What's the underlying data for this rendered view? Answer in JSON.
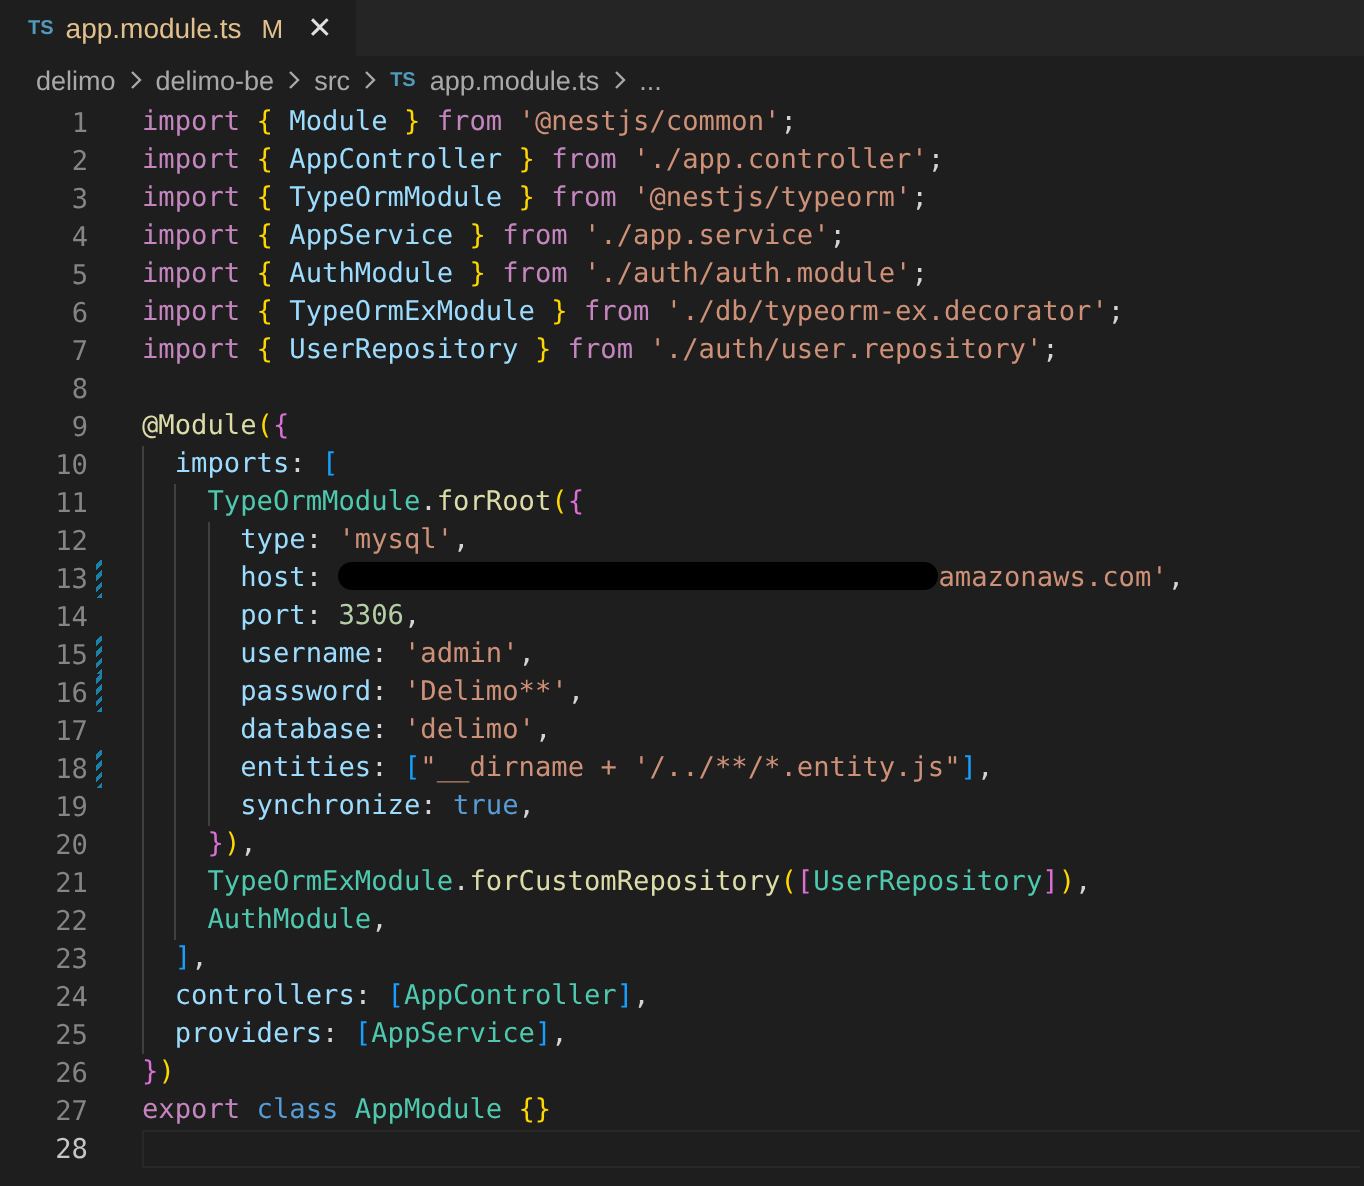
{
  "tab": {
    "icon_label": "TS",
    "title": "app.module.ts",
    "status": "M",
    "selected": true,
    "modified": true,
    "close": "✕"
  },
  "breadcrumbs": [
    {
      "text": "delimo"
    },
    {
      "text": "delimo-be"
    },
    {
      "text": "src"
    },
    {
      "text": "app.module.ts",
      "icon_label": "TS"
    },
    {
      "text": "..."
    }
  ],
  "lines": [
    {
      "number": "1",
      "modified": false,
      "current": false,
      "tokens": [
        {
          "kind": "kw",
          "text": "import "
        },
        {
          "kind": "b1",
          "text": "{"
        },
        {
          "kind": "var",
          "text": " Module "
        },
        {
          "kind": "b1",
          "text": "}"
        },
        {
          "kind": "kw",
          "text": " from "
        },
        {
          "kind": "str",
          "text": "'@nestjs/common'"
        },
        {
          "kind": "p",
          "text": ";"
        }
      ]
    },
    {
      "number": "2",
      "modified": false,
      "current": false,
      "tokens": [
        {
          "kind": "kw",
          "text": "import "
        },
        {
          "kind": "b1",
          "text": "{"
        },
        {
          "kind": "var",
          "text": " AppController "
        },
        {
          "kind": "b1",
          "text": "}"
        },
        {
          "kind": "kw",
          "text": " from "
        },
        {
          "kind": "str",
          "text": "'./app.controller'"
        },
        {
          "kind": "p",
          "text": ";"
        }
      ]
    },
    {
      "number": "3",
      "modified": false,
      "current": false,
      "tokens": [
        {
          "kind": "kw",
          "text": "import "
        },
        {
          "kind": "b1",
          "text": "{"
        },
        {
          "kind": "var",
          "text": " TypeOrmModule "
        },
        {
          "kind": "b1",
          "text": "}"
        },
        {
          "kind": "kw",
          "text": " from "
        },
        {
          "kind": "str",
          "text": "'@nestjs/typeorm'"
        },
        {
          "kind": "p",
          "text": ";"
        }
      ]
    },
    {
      "number": "4",
      "modified": false,
      "current": false,
      "tokens": [
        {
          "kind": "kw",
          "text": "import "
        },
        {
          "kind": "b1",
          "text": "{"
        },
        {
          "kind": "var",
          "text": " AppService "
        },
        {
          "kind": "b1",
          "text": "}"
        },
        {
          "kind": "kw",
          "text": " from "
        },
        {
          "kind": "str",
          "text": "'./app.service'"
        },
        {
          "kind": "p",
          "text": ";"
        }
      ]
    },
    {
      "number": "5",
      "modified": false,
      "current": false,
      "tokens": [
        {
          "kind": "kw",
          "text": "import "
        },
        {
          "kind": "b1",
          "text": "{"
        },
        {
          "kind": "var",
          "text": " AuthModule "
        },
        {
          "kind": "b1",
          "text": "}"
        },
        {
          "kind": "kw",
          "text": " from "
        },
        {
          "kind": "str",
          "text": "'./auth/auth.module'"
        },
        {
          "kind": "p",
          "text": ";"
        }
      ]
    },
    {
      "number": "6",
      "modified": false,
      "current": false,
      "tokens": [
        {
          "kind": "kw",
          "text": "import "
        },
        {
          "kind": "b1",
          "text": "{"
        },
        {
          "kind": "var",
          "text": " TypeOrmExModule "
        },
        {
          "kind": "b1",
          "text": "}"
        },
        {
          "kind": "kw",
          "text": " from "
        },
        {
          "kind": "str",
          "text": "'./db/typeorm-ex.decorator'"
        },
        {
          "kind": "p",
          "text": ";"
        }
      ]
    },
    {
      "number": "7",
      "modified": false,
      "current": false,
      "tokens": [
        {
          "kind": "kw",
          "text": "import "
        },
        {
          "kind": "b1",
          "text": "{"
        },
        {
          "kind": "var",
          "text": " UserRepository "
        },
        {
          "kind": "b1",
          "text": "}"
        },
        {
          "kind": "kw",
          "text": " from "
        },
        {
          "kind": "str",
          "text": "'./auth/user.repository'"
        },
        {
          "kind": "p",
          "text": ";"
        }
      ]
    },
    {
      "number": "8",
      "modified": false,
      "current": false
    },
    {
      "number": "9",
      "modified": false,
      "current": false,
      "tokens": [
        {
          "kind": "fn",
          "text": "@Module"
        },
        {
          "kind": "b1",
          "text": "("
        },
        {
          "kind": "b2",
          "text": "{"
        }
      ]
    },
    {
      "number": "10",
      "modified": false,
      "current": false,
      "tokens": [
        {
          "kind": "indent"
        },
        {
          "kind": "var",
          "text": "imports"
        },
        {
          "kind": "p",
          "text": ": "
        },
        {
          "kind": "b3",
          "text": "["
        }
      ]
    },
    {
      "number": "11",
      "modified": false,
      "current": false,
      "tokens": [
        {
          "kind": "indent"
        },
        {
          "kind": "indent"
        },
        {
          "kind": "type",
          "text": "TypeOrmModule"
        },
        {
          "kind": "p",
          "text": "."
        },
        {
          "kind": "fn",
          "text": "forRoot"
        },
        {
          "kind": "b1",
          "text": "("
        },
        {
          "kind": "b2",
          "text": "{"
        }
      ]
    },
    {
      "number": "12",
      "modified": false,
      "current": false,
      "tokens": [
        {
          "kind": "indent"
        },
        {
          "kind": "indent"
        },
        {
          "kind": "indent"
        },
        {
          "kind": "var",
          "text": "type"
        },
        {
          "kind": "p",
          "text": ": "
        },
        {
          "kind": "str",
          "text": "'mysql'"
        },
        {
          "kind": "p",
          "text": ","
        }
      ]
    },
    {
      "number": "13",
      "modified": true,
      "current": false,
      "tokens": [
        {
          "kind": "indent"
        },
        {
          "kind": "indent"
        },
        {
          "kind": "indent"
        },
        {
          "kind": "var",
          "text": "host"
        },
        {
          "kind": "p",
          "text": ": "
        },
        {
          "kind": "redacted"
        },
        {
          "kind": "str",
          "text": "amazonaws.com'"
        },
        {
          "kind": "p",
          "text": ","
        }
      ]
    },
    {
      "number": "14",
      "modified": false,
      "current": false,
      "tokens": [
        {
          "kind": "indent"
        },
        {
          "kind": "indent"
        },
        {
          "kind": "indent"
        },
        {
          "kind": "var",
          "text": "port"
        },
        {
          "kind": "p",
          "text": ": "
        },
        {
          "kind": "num",
          "text": "3306"
        },
        {
          "kind": "p",
          "text": ","
        }
      ]
    },
    {
      "number": "15",
      "modified": true,
      "current": false,
      "tokens": [
        {
          "kind": "indent"
        },
        {
          "kind": "indent"
        },
        {
          "kind": "indent"
        },
        {
          "kind": "var",
          "text": "username"
        },
        {
          "kind": "p",
          "text": ": "
        },
        {
          "kind": "str",
          "text": "'admin'"
        },
        {
          "kind": "p",
          "text": ","
        }
      ]
    },
    {
      "number": "16",
      "modified": true,
      "current": false,
      "tokens": [
        {
          "kind": "indent"
        },
        {
          "kind": "indent"
        },
        {
          "kind": "indent"
        },
        {
          "kind": "var",
          "text": "password"
        },
        {
          "kind": "p",
          "text": ": "
        },
        {
          "kind": "str",
          "text": "'Delimo**'"
        },
        {
          "kind": "p",
          "text": ","
        }
      ]
    },
    {
      "number": "17",
      "modified": false,
      "current": false,
      "tokens": [
        {
          "kind": "indent"
        },
        {
          "kind": "indent"
        },
        {
          "kind": "indent"
        },
        {
          "kind": "var",
          "text": "database"
        },
        {
          "kind": "p",
          "text": ": "
        },
        {
          "kind": "str",
          "text": "'delimo'"
        },
        {
          "kind": "p",
          "text": ","
        }
      ]
    },
    {
      "number": "18",
      "modified": true,
      "current": false,
      "tokens": [
        {
          "kind": "indent"
        },
        {
          "kind": "indent"
        },
        {
          "kind": "indent"
        },
        {
          "kind": "var",
          "text": "entities"
        },
        {
          "kind": "p",
          "text": ": "
        },
        {
          "kind": "b3",
          "text": "["
        },
        {
          "kind": "str",
          "text": "\"__dirname + '/../**/*.entity.js\""
        },
        {
          "kind": "b3",
          "text": "]"
        },
        {
          "kind": "p",
          "text": ","
        }
      ]
    },
    {
      "number": "19",
      "modified": false,
      "current": false,
      "tokens": [
        {
          "kind": "indent"
        },
        {
          "kind": "indent"
        },
        {
          "kind": "indent"
        },
        {
          "kind": "var",
          "text": "synchronize"
        },
        {
          "kind": "p",
          "text": ": "
        },
        {
          "kind": "const",
          "text": "true"
        },
        {
          "kind": "p",
          "text": ","
        }
      ]
    },
    {
      "number": "20",
      "modified": false,
      "current": false,
      "tokens": [
        {
          "kind": "indent"
        },
        {
          "kind": "indent"
        },
        {
          "kind": "b2",
          "text": "}"
        },
        {
          "kind": "b1",
          "text": ")"
        },
        {
          "kind": "p",
          "text": ","
        }
      ]
    },
    {
      "number": "21",
      "modified": false,
      "current": false,
      "tokens": [
        {
          "kind": "indent"
        },
        {
          "kind": "indent"
        },
        {
          "kind": "type",
          "text": "TypeOrmExModule"
        },
        {
          "kind": "p",
          "text": "."
        },
        {
          "kind": "fn",
          "text": "forCustomRepository"
        },
        {
          "kind": "b1",
          "text": "("
        },
        {
          "kind": "b2",
          "text": "["
        },
        {
          "kind": "type",
          "text": "UserRepository"
        },
        {
          "kind": "b2",
          "text": "]"
        },
        {
          "kind": "b1",
          "text": ")"
        },
        {
          "kind": "p",
          "text": ","
        }
      ]
    },
    {
      "number": "22",
      "modified": false,
      "current": false,
      "tokens": [
        {
          "kind": "indent"
        },
        {
          "kind": "indent"
        },
        {
          "kind": "type",
          "text": "AuthModule"
        },
        {
          "kind": "p",
          "text": ","
        }
      ]
    },
    {
      "number": "23",
      "modified": false,
      "current": false,
      "tokens": [
        {
          "kind": "indent"
        },
        {
          "kind": "b3",
          "text": "]"
        },
        {
          "kind": "p",
          "text": ","
        }
      ]
    },
    {
      "number": "24",
      "modified": false,
      "current": false,
      "tokens": [
        {
          "kind": "indent"
        },
        {
          "kind": "var",
          "text": "controllers"
        },
        {
          "kind": "p",
          "text": ": "
        },
        {
          "kind": "b3",
          "text": "["
        },
        {
          "kind": "type",
          "text": "AppController"
        },
        {
          "kind": "b3",
          "text": "]"
        },
        {
          "kind": "p",
          "text": ","
        }
      ]
    },
    {
      "number": "25",
      "modified": false,
      "current": false,
      "tokens": [
        {
          "kind": "indent"
        },
        {
          "kind": "var",
          "text": "providers"
        },
        {
          "kind": "p",
          "text": ": "
        },
        {
          "kind": "b3",
          "text": "["
        },
        {
          "kind": "type",
          "text": "AppService"
        },
        {
          "kind": "b3",
          "text": "]"
        },
        {
          "kind": "p",
          "text": ","
        }
      ]
    },
    {
      "number": "26",
      "modified": false,
      "current": false,
      "tokens": [
        {
          "kind": "b2",
          "text": "}"
        },
        {
          "kind": "b1",
          "text": ")"
        }
      ]
    },
    {
      "number": "27",
      "modified": false,
      "current": false,
      "tokens": [
        {
          "kind": "kw",
          "text": "export "
        },
        {
          "kind": "storage",
          "text": "class "
        },
        {
          "kind": "type",
          "text": "AppModule "
        },
        {
          "kind": "b1",
          "text": "{}"
        }
      ]
    },
    {
      "number": "28",
      "modified": false,
      "current": true
    }
  ]
}
